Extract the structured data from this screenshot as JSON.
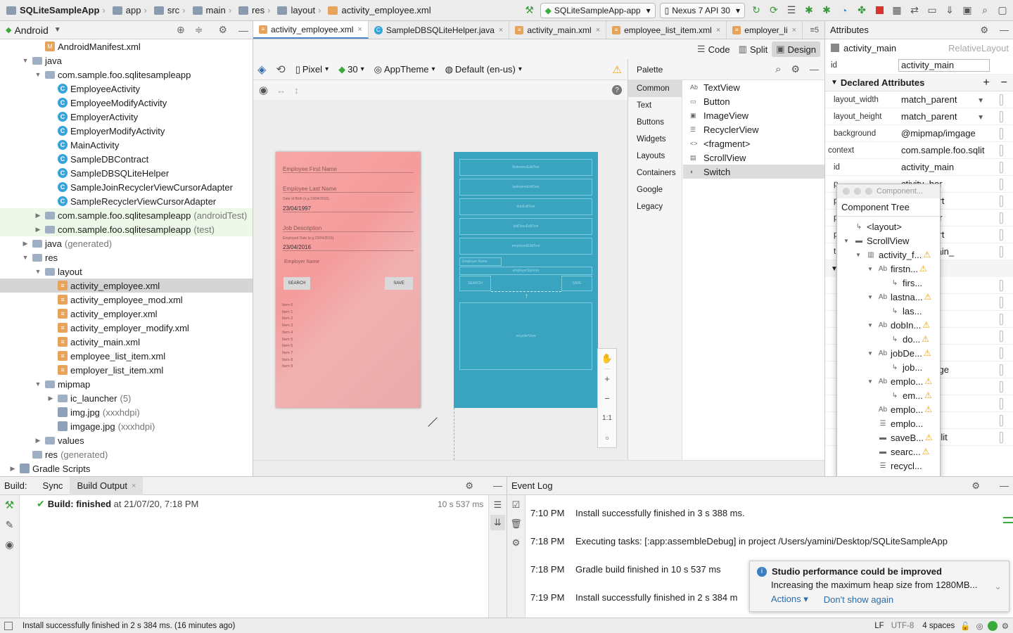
{
  "breadcrumb": [
    "SQLiteSampleApp",
    "app",
    "src",
    "main",
    "res",
    "layout",
    "activity_employee.xml"
  ],
  "toolbar": {
    "run_config": "SQLiteSampleApp-app",
    "device": "Nexus 7 API 30"
  },
  "project": {
    "view": "Android",
    "items": [
      {
        "label": "AndroidManifest.xml",
        "depth": 2,
        "icon": "manifest",
        "arrow": ""
      },
      {
        "label": "java",
        "depth": 1,
        "icon": "folder",
        "arrow": "▼"
      },
      {
        "label": "com.sample.foo.sqlitesampleapp",
        "depth": 2,
        "icon": "folder",
        "arrow": "▼"
      },
      {
        "label": "EmployeeActivity",
        "depth": 3,
        "icon": "class",
        "arrow": ""
      },
      {
        "label": "EmployeeModifyActivity",
        "depth": 3,
        "icon": "class",
        "arrow": ""
      },
      {
        "label": "EmployerActivity",
        "depth": 3,
        "icon": "class",
        "arrow": ""
      },
      {
        "label": "EmployerModifyActivity",
        "depth": 3,
        "icon": "class",
        "arrow": ""
      },
      {
        "label": "MainActivity",
        "depth": 3,
        "icon": "class",
        "arrow": ""
      },
      {
        "label": "SampleDBContract",
        "depth": 3,
        "icon": "class",
        "arrow": ""
      },
      {
        "label": "SampleDBSQLiteHelper",
        "depth": 3,
        "icon": "class",
        "arrow": ""
      },
      {
        "label": "SampleJoinRecyclerViewCursorAdapter",
        "depth": 3,
        "icon": "class",
        "arrow": ""
      },
      {
        "label": "SampleRecyclerViewCursorAdapter",
        "depth": 3,
        "icon": "class",
        "arrow": ""
      },
      {
        "label": "com.sample.foo.sqlitesampleapp",
        "suffix": "(androidTest)",
        "depth": 2,
        "icon": "folder",
        "arrow": "▶",
        "style": "green"
      },
      {
        "label": "com.sample.foo.sqlitesampleapp",
        "suffix": "(test)",
        "depth": 2,
        "icon": "folder",
        "arrow": "▶",
        "style": "green"
      },
      {
        "label": "java",
        "suffix": "(generated)",
        "depth": 1,
        "icon": "folder",
        "arrow": "▶"
      },
      {
        "label": "res",
        "depth": 1,
        "icon": "folder",
        "arrow": "▼"
      },
      {
        "label": "layout",
        "depth": 2,
        "icon": "folder",
        "arrow": "▼"
      },
      {
        "label": "activity_employee.xml",
        "depth": 3,
        "icon": "xml",
        "arrow": "",
        "style": "sel"
      },
      {
        "label": "activity_employee_mod.xml",
        "depth": 3,
        "icon": "xml",
        "arrow": ""
      },
      {
        "label": "activity_employer.xml",
        "depth": 3,
        "icon": "xml",
        "arrow": ""
      },
      {
        "label": "activity_employer_modify.xml",
        "depth": 3,
        "icon": "xml",
        "arrow": ""
      },
      {
        "label": "activity_main.xml",
        "depth": 3,
        "icon": "xml",
        "arrow": ""
      },
      {
        "label": "employee_list_item.xml",
        "depth": 3,
        "icon": "xml",
        "arrow": ""
      },
      {
        "label": "employer_list_item.xml",
        "depth": 3,
        "icon": "xml",
        "arrow": ""
      },
      {
        "label": "mipmap",
        "depth": 2,
        "icon": "folder",
        "arrow": "▼"
      },
      {
        "label": "ic_launcher",
        "suffix": "(5)",
        "depth": 3,
        "icon": "folder",
        "arrow": "▶"
      },
      {
        "label": "img.jpg",
        "suffix": "(xxxhdpi)",
        "depth": 3,
        "icon": "img",
        "arrow": ""
      },
      {
        "label": "imgage.jpg",
        "suffix": "(xxxhdpi)",
        "depth": 3,
        "icon": "img",
        "arrow": ""
      },
      {
        "label": "values",
        "depth": 2,
        "icon": "folder",
        "arrow": "▶"
      },
      {
        "label": "res",
        "suffix": "(generated)",
        "depth": 1,
        "icon": "folder",
        "arrow": ""
      },
      {
        "label": "Gradle Scripts",
        "depth": 0,
        "icon": "gradle",
        "arrow": "▶"
      }
    ]
  },
  "editor_tabs": [
    {
      "label": "activity_employee.xml",
      "icon": "xml",
      "active": true
    },
    {
      "label": "SampleDBSQLiteHelper.java",
      "icon": "class"
    },
    {
      "label": "activity_main.xml",
      "icon": "xml"
    },
    {
      "label": "employee_list_item.xml",
      "icon": "xml"
    },
    {
      "label": "employer_li",
      "icon": "xml"
    }
  ],
  "tab_overflow": "≡5",
  "view_modes": {
    "code": "Code",
    "split": "Split",
    "design": "Design"
  },
  "design_toolbar": {
    "device": "Pixel",
    "api": "30",
    "theme": "AppTheme",
    "locale": "Default (en-us)"
  },
  "preview": {
    "first_name": "Employee First Name",
    "last_name": "Employee Last Name",
    "dob_hint": "Date of Birth (e.g 23/04/2016)",
    "dob_value": "23/04/1997",
    "job_desc": "Job Description",
    "employed_hint": "Employed Date (e.g 23/04/2016)",
    "employed_value": "23/04/2016",
    "employer_name": "Employer Name",
    "search_btn": "SEARCH",
    "save_btn": "SAVE",
    "list_items": [
      "Item 0",
      "Item 1",
      "Item 2",
      "Item 3",
      "Item 4",
      "Item 5",
      "Item 6",
      "Item 7",
      "Item 8",
      "Item 9"
    ]
  },
  "blueprint": {
    "fields": [
      "firstnameEditText",
      "lastnameEditText",
      "dobEditText",
      "jobDescEditText",
      "employedEditText"
    ],
    "employer_label": "Employer Name",
    "spinner": "employerSpinner",
    "search": "SEARCH",
    "save": "SAVE",
    "recycler": "recyclerView"
  },
  "zoom": {
    "zoom_in": "+",
    "zoom_out": "−",
    "one_to_one": "1:1"
  },
  "palette": {
    "title": "Palette",
    "categories": [
      "Common",
      "Text",
      "Buttons",
      "Widgets",
      "Layouts",
      "Containers",
      "Google",
      "Legacy"
    ],
    "items": [
      {
        "icon": "Ab",
        "label": "TextView"
      },
      {
        "icon": "▭",
        "label": "Button"
      },
      {
        "icon": "▣",
        "label": "ImageView"
      },
      {
        "icon": "☰",
        "label": "RecyclerView"
      },
      {
        "icon": "<>",
        "label": "<fragment>"
      },
      {
        "icon": "▤",
        "label": "ScrollView"
      },
      {
        "icon": "◐",
        "label": "Switch",
        "selected": true
      }
    ]
  },
  "attributes": {
    "title": "Attributes",
    "component": "activity_main",
    "component_type": "RelativeLayout",
    "id_label": "id",
    "id_value": "activity_main",
    "declared_title": "Declared Attributes",
    "rows": [
      {
        "key": "layout_width",
        "value": "match_parent",
        "dropdown": true
      },
      {
        "key": "layout_height",
        "value": "match_parent",
        "dropdown": true
      },
      {
        "key": "background",
        "value": "@mipmap/imgage"
      },
      {
        "key": "context",
        "value": "com.sample.foo.sqlit"
      },
      {
        "key": "id",
        "value": "activity_main"
      },
      {
        "key": "p",
        "value": "ctivity_hor"
      },
      {
        "key": "p",
        "value": "ctivity_vert"
      },
      {
        "key": "p",
        "value": "ctivity_hor"
      },
      {
        "key": "p",
        "value": "ctivity_vert"
      },
      {
        "key": "t",
        "value": "ctivity_main_"
      }
    ],
    "lower_rows": [
      "",
      "",
      "",
      "",
      "",
      "nap/imgage",
      "",
      "",
      "",
      "ple.foo.sqlit"
    ]
  },
  "component_tree": {
    "window_title": "Component...",
    "title": "Component Tree",
    "rows": [
      {
        "label": "<layout>",
        "depth": 0,
        "arrow": "",
        "icon": "↳",
        "warn": false
      },
      {
        "label": "ScrollView",
        "depth": 0,
        "arrow": "▼",
        "icon": "▬",
        "warn": false
      },
      {
        "label": "activity_f...",
        "depth": 1,
        "arrow": "▼",
        "icon": "▥",
        "warn": true
      },
      {
        "label": "firstn...",
        "depth": 2,
        "arrow": "▼",
        "icon": "Ab",
        "warn": true
      },
      {
        "label": "firs...",
        "depth": 3,
        "arrow": "",
        "icon": "↳",
        "warn": false
      },
      {
        "label": "lastna...",
        "depth": 2,
        "arrow": "▼",
        "icon": "Ab",
        "warn": true
      },
      {
        "label": "las...",
        "depth": 3,
        "arrow": "",
        "icon": "↳",
        "warn": false
      },
      {
        "label": "dobIn...",
        "depth": 2,
        "arrow": "▼",
        "icon": "Ab",
        "warn": true
      },
      {
        "label": "do...",
        "depth": 3,
        "arrow": "",
        "icon": "↳",
        "warn": true
      },
      {
        "label": "jobDe...",
        "depth": 2,
        "arrow": "▼",
        "icon": "Ab",
        "warn": true
      },
      {
        "label": "job...",
        "depth": 3,
        "arrow": "",
        "icon": "↳",
        "warn": false
      },
      {
        "label": "emplo...",
        "depth": 2,
        "arrow": "▼",
        "icon": "Ab",
        "warn": true
      },
      {
        "label": "em...",
        "depth": 3,
        "arrow": "",
        "icon": "↳",
        "warn": true
      },
      {
        "label": "emplo...",
        "depth": 2,
        "arrow": "",
        "icon": "Ab",
        "warn": true
      },
      {
        "label": "emplo...",
        "depth": 2,
        "arrow": "",
        "icon": "☰",
        "warn": false
      },
      {
        "label": "saveB...",
        "depth": 2,
        "arrow": "",
        "icon": "▬",
        "warn": true
      },
      {
        "label": "searc...",
        "depth": 2,
        "arrow": "",
        "icon": "▬",
        "warn": true
      },
      {
        "label": "recycl...",
        "depth": 2,
        "arrow": "",
        "icon": "☰",
        "warn": false
      }
    ]
  },
  "build": {
    "label": "Build:",
    "tabs": [
      "Sync",
      "Build Output"
    ],
    "status_prefix": "Build:",
    "status": "finished",
    "status_time": "at 21/07/20, 7:18 PM",
    "duration": "10 s 537 ms"
  },
  "event_log": {
    "title": "Event Log",
    "entries": [
      {
        "time": "7:10 PM",
        "text": "Install successfully finished in 3 s 388 ms."
      },
      {
        "time": "7:18 PM",
        "text": "Executing tasks: [:app:assembleDebug] in project /Users/yamini/Desktop/SQLiteSampleApp"
      },
      {
        "time": "7:18 PM",
        "text": "Gradle build finished in 10 s 537 ms"
      },
      {
        "time": "7:19 PM",
        "text": "Install successfully finished in 2 s 384 m"
      }
    ]
  },
  "notification": {
    "title": "Studio performance could be improved",
    "body": "Increasing the maximum heap size from 1280MB...",
    "actions": "Actions",
    "dismiss": "Don't show again"
  },
  "statusbar": {
    "message": "Install successfully finished in 2 s 384 ms. (16 minutes ago)",
    "line_sep": "LF",
    "encoding": "UTF-8",
    "indent": "4 spaces"
  },
  "colors": {
    "accent": "#4a86c8",
    "warning": "#e8a300",
    "build_green": "#3aaa3a",
    "blueprint": "#3aa3c0"
  }
}
